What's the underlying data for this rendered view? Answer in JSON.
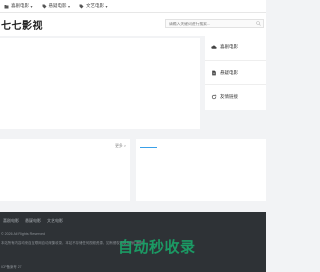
{
  "nav": {
    "items": [
      {
        "label": "喜剧电影",
        "icon": "folder-icon"
      },
      {
        "label": "悬疑电影",
        "icon": "tag-icon"
      },
      {
        "label": "文艺电影",
        "icon": "tag-icon"
      }
    ]
  },
  "header": {
    "site_title": "七七影视",
    "search_placeholder": "请输入关键词进行搜索..."
  },
  "sidebar": {
    "items": [
      {
        "label": "喜剧电影",
        "icon": "cloud-icon"
      },
      {
        "label": "悬疑电影",
        "icon": "document-icon"
      },
      {
        "label": "友情链接",
        "icon": "refresh-icon"
      }
    ]
  },
  "main": {
    "more_label": "更多 >"
  },
  "footer": {
    "links": [
      "喜剧电影",
      "悬疑电影",
      "文艺电影"
    ],
    "copyright": "© 2026 All Rights Reserved",
    "description": "本站所有内容均来自互联网自动采集收录，本站不存储任何视频资源，如有侵权请联系我们删除。",
    "icp": "ICP备案号 27"
  },
  "watermark": {
    "text": "自动秒收录"
  },
  "colors": {
    "accent": "#3aa0e8",
    "footer_bg": "#2e3236",
    "watermark": "#1aa368"
  }
}
